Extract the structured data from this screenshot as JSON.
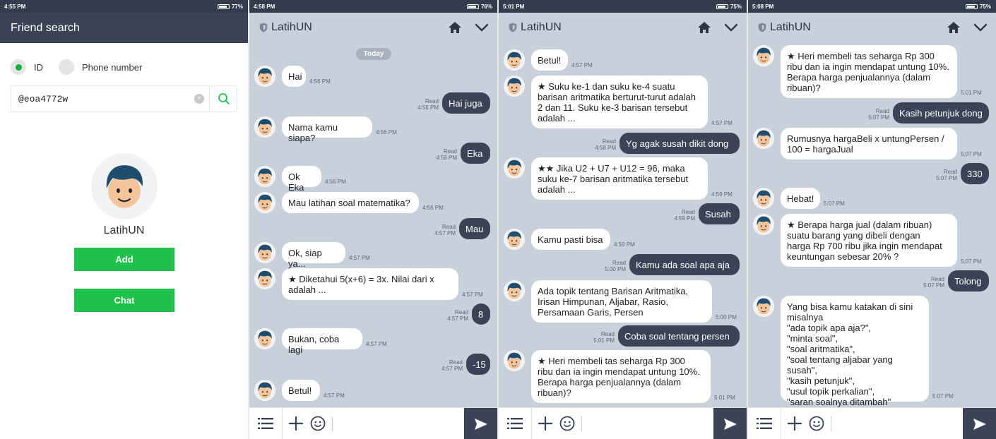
{
  "colors": {
    "status_bar": "#333c4c",
    "header_dark": "#3b4457",
    "chat_background": "#c8d0dc",
    "outgoing_bubble": "#3b4457",
    "incoming_bubble": "#ffffff",
    "accent_green": "#1ec24a"
  },
  "friend_search": {
    "status_time": "4:55 PM",
    "battery": "77%",
    "title": "Friend search",
    "radio_id_label": "ID",
    "radio_phone_label": "Phone number",
    "search_value": "@eoa4772w",
    "profile_name": "LatihUN",
    "add_label": "Add",
    "chat_label": "Chat",
    "icons": [
      "clear-icon",
      "search-icon",
      "avatar-icon"
    ]
  },
  "chats": [
    {
      "status_time": "4:58 PM",
      "battery": "76%",
      "title": "LatihUN",
      "date_label": "Today",
      "messages": [
        {
          "from": "bot",
          "text": "Hai",
          "time": "4:56 PM"
        },
        {
          "from": "me",
          "text": "Hai juga",
          "read": "Read",
          "time": "4:56 PM"
        },
        {
          "from": "bot",
          "text": "Nama kamu siapa?",
          "time": "4:56 PM"
        },
        {
          "from": "me",
          "text": "Eka",
          "read": "Read",
          "time": "4:56 PM"
        },
        {
          "from": "bot",
          "text": "Ok Eka",
          "time": "4:56 PM"
        },
        {
          "from": "bot",
          "text": "Mau latihan soal matematika?",
          "time": "4:56 PM"
        },
        {
          "from": "me",
          "text": "Mau",
          "read": "Read",
          "time": "4:57 PM"
        },
        {
          "from": "bot",
          "text": "Ok, siap ya...",
          "time": "4:57 PM"
        },
        {
          "from": "bot",
          "text": "★ Diketahui 5(x+6) = 3x. Nilai dari x\nadalah ...",
          "time": "4:57 PM"
        },
        {
          "from": "me",
          "text": "8",
          "read": "Read",
          "time": "4:57 PM"
        },
        {
          "from": "bot",
          "text": "Bukan, coba lagi",
          "time": "4:57 PM"
        },
        {
          "from": "me",
          "text": "-15",
          "read": "Read",
          "time": "4:57 PM"
        },
        {
          "from": "bot",
          "text": "Betul!",
          "time": "4:57 PM"
        }
      ]
    },
    {
      "status_time": "5:01 PM",
      "battery": "75%",
      "title": "LatihUN",
      "messages": [
        {
          "from": "bot",
          "text": "Betul!",
          "time": "4:57 PM"
        },
        {
          "from": "bot",
          "text": "★ Suku ke-1 dan suku ke-4 suatu\nbarisan aritmatika berturut-turut adalah\n2 dan 11. Suku ke-3 barisan tersebut\nadalah ...",
          "time": "4:57 PM"
        },
        {
          "from": "me",
          "text": "Yg agak susah dikit dong",
          "read": "Read",
          "time": "4:58 PM"
        },
        {
          "from": "bot",
          "text": "★★ Jika U2 + U7 + U12 = 96, maka\nsuku ke-7 barisan aritmatika tersebut\nadalah ...",
          "time": "4:59 PM"
        },
        {
          "from": "me",
          "text": "Susah",
          "read": "Read",
          "time": "4:59 PM"
        },
        {
          "from": "bot",
          "text": "Kamu pasti bisa",
          "time": "4:59 PM"
        },
        {
          "from": "me",
          "text": "Kamu ada soal apa aja",
          "read": "Read",
          "time": "5:00 PM"
        },
        {
          "from": "bot",
          "text": "Ada topik tentang Barisan Aritmatika,\nIrisan Himpunan, Aljabar, Rasio,\nPersamaan Garis, Persen",
          "time": "5:00 PM"
        },
        {
          "from": "me",
          "text": "Coba soal tentang persen",
          "read": "Read",
          "time": "5:01 PM"
        },
        {
          "from": "bot",
          "text": "★ Heri membeli tas seharga Rp 300\nribu dan ia ingin mendapat untung 10%.\nBerapa harga penjualannya (dalam\nribuan)?",
          "time": "5:01 PM"
        }
      ]
    },
    {
      "status_time": "5:08 PM",
      "battery": "75%",
      "title": "LatihUN",
      "messages": [
        {
          "from": "bot",
          "text": "★ Heri membeli tas seharga Rp 300\nribu dan ia ingin mendapat untung 10%.\nBerapa harga penjualannya (dalam\nribuan)?",
          "time": "5:01 PM"
        },
        {
          "from": "me",
          "text": "Kasih petunjuk dong",
          "read": "Read",
          "time": "5:07 PM"
        },
        {
          "from": "bot",
          "text": "Rumusnya hargaBeli x untungPersen /\n100 = hargaJual",
          "time": "5:07 PM"
        },
        {
          "from": "me",
          "text": "330",
          "read": "Read",
          "time": "5:07 PM"
        },
        {
          "from": "bot",
          "text": "Hebat!",
          "time": "5:07 PM"
        },
        {
          "from": "bot",
          "text": "★ Berapa harga jual (dalam ribuan)\nsuatu barang yang dibeli dengan\nharga Rp 700 ribu jika ingin mendapat\nkeuntungan sebesar 20% ?",
          "time": "5:07 PM"
        },
        {
          "from": "me",
          "text": "Tolong",
          "read": "Read",
          "time": "5:07 PM"
        },
        {
          "from": "bot",
          "text": "Yang bisa kamu katakan di sini\nmisalnya\n\"ada topik apa aja?\",\n\"minta soal\",\n\"soal aritmatika\",\n\"soal tentang aljabar yang susah\",\n\"kasih petunjuk\",\n\"usul topik perkalian\",\n\"saran soalnya ditambah\"",
          "time": "5:07 PM"
        }
      ]
    }
  ]
}
